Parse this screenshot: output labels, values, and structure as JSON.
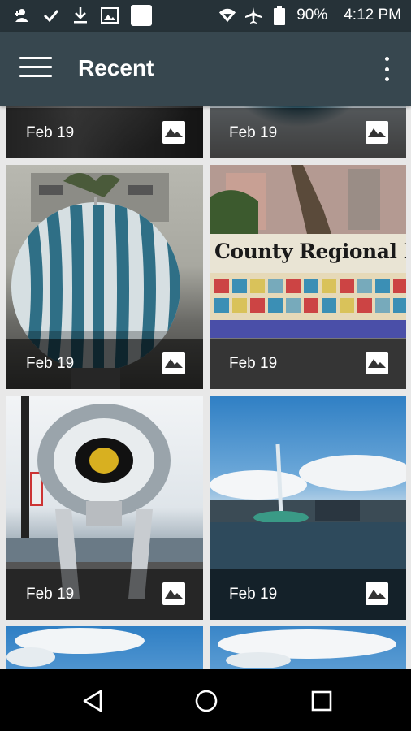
{
  "status_bar": {
    "battery": "90%",
    "time": "4:12 PM",
    "left_icons": [
      "person-add-icon",
      "check-icon",
      "download-icon",
      "image-icon",
      "app-square-icon"
    ],
    "right_icons": [
      "wifi-icon",
      "airplane-icon",
      "battery-icon"
    ]
  },
  "app_bar": {
    "title": "Recent",
    "menu_icon": "hamburger-menu-icon",
    "more_icon": "more-vert-icon"
  },
  "photos": [
    {
      "date": "Feb 19",
      "subject": "statue base",
      "type_icon": "image-icon"
    },
    {
      "date": "Feb 19",
      "subject": "striped sphere top",
      "type_icon": "image-icon"
    },
    {
      "date": "Feb 19",
      "subject": "striped sphere sculpture",
      "type_icon": "image-icon"
    },
    {
      "date": "Feb 19",
      "subject": "county regional history sign",
      "type_icon": "image-icon",
      "sign_text": "County Regional History"
    },
    {
      "date": "Feb 19",
      "subject": "eye sculpture",
      "type_icon": "image-icon"
    },
    {
      "date": "Feb 19",
      "subject": "lake fountain",
      "type_icon": "image-icon"
    },
    {
      "subject": "sky clouds"
    },
    {
      "subject": "sky clouds"
    }
  ],
  "nav_bar": {
    "icons": [
      "back-icon",
      "home-icon",
      "recents-icon"
    ]
  },
  "colors": {
    "status_bar": "#263238",
    "app_bar": "#37474f",
    "background": "#e8e8e8"
  }
}
